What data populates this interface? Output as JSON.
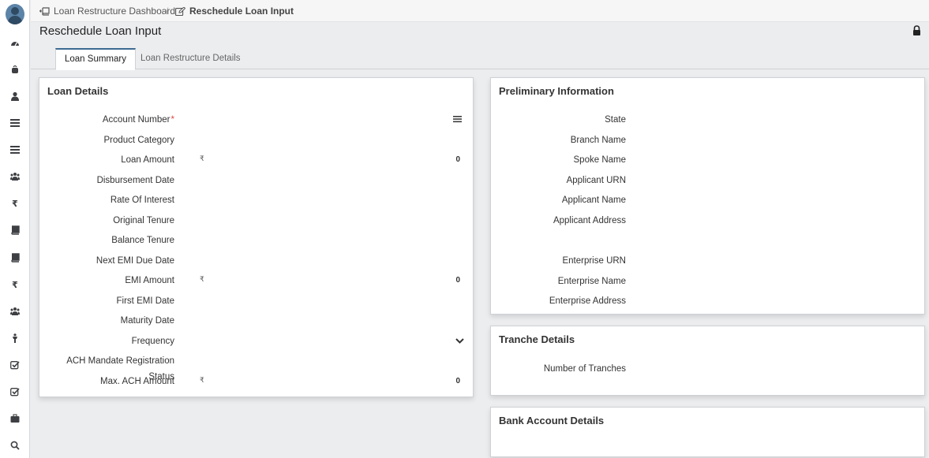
{
  "breadcrumb": {
    "parent_label": "Loan Restructure Dashboard",
    "separator": "/",
    "current_label": "Reschedule Loan Input"
  },
  "page": {
    "title": "Reschedule Loan Input"
  },
  "tabs": [
    {
      "label": "Loan Summary",
      "active": true
    },
    {
      "label": "Loan Restructure Details",
      "active": false
    }
  ],
  "sidebar": {
    "icons": [
      "dashboard-icon",
      "bag-icon",
      "user-icon",
      "list-icon",
      "list-alt-icon",
      "users-icon",
      "rupee-icon",
      "book-icon",
      "book-alt-icon",
      "rupee-alt-icon",
      "users-alt-icon",
      "person-icon",
      "checkbox-icon",
      "checkbox-alt-icon",
      "briefcase-icon",
      "search-icon"
    ],
    "rupee_glyph": "₹"
  },
  "loan_details": {
    "title": "Loan Details",
    "required_marker": "*",
    "currency": "₹",
    "fields": {
      "account_number": {
        "label": "Account Number"
      },
      "product_category": {
        "label": "Product Category"
      },
      "loan_amount": {
        "label": "Loan Amount",
        "value": "0"
      },
      "disbursement_date": {
        "label": "Disbursement Date"
      },
      "rate_of_interest": {
        "label": "Rate Of Interest"
      },
      "original_tenure": {
        "label": "Original Tenure"
      },
      "balance_tenure": {
        "label": "Balance Tenure"
      },
      "next_emi_due_date": {
        "label": "Next EMI Due Date"
      },
      "emi_amount": {
        "label": "EMI Amount",
        "value": "0"
      },
      "first_emi_date": {
        "label": "First EMI Date"
      },
      "maturity_date": {
        "label": "Maturity Date"
      },
      "frequency": {
        "label": "Frequency"
      },
      "ach_status": {
        "label": "ACH Mandate Registration Status"
      },
      "max_ach_amount": {
        "label": "Max. ACH Amount",
        "value": "0"
      }
    }
  },
  "preliminary": {
    "title": "Preliminary Information",
    "fields": {
      "state": "State",
      "branch_name": "Branch Name",
      "spoke_name": "Spoke Name",
      "applicant_urn": "Applicant URN",
      "applicant_name": "Applicant Name",
      "applicant_address": "Applicant Address",
      "enterprise_urn": "Enterprise URN",
      "enterprise_name": "Enterprise Name",
      "enterprise_address": "Enterprise Address"
    }
  },
  "tranche": {
    "title": "Tranche Details",
    "number_of_tranches_label": "Number of Tranches"
  },
  "bank_account": {
    "title": "Bank Account Details"
  },
  "colors": {
    "accent": "#3d6a92",
    "required": "#e04848",
    "background": "#ecedef"
  }
}
